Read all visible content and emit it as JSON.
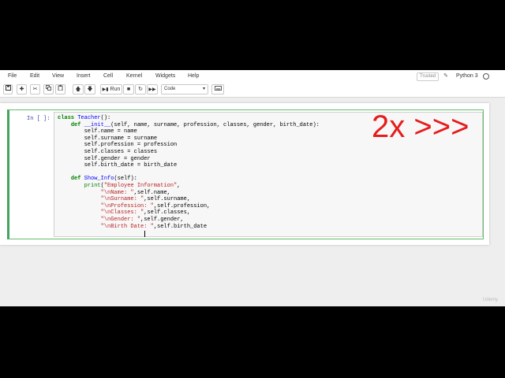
{
  "menubar": {
    "items": [
      "File",
      "Edit",
      "View",
      "Insert",
      "Cell",
      "Kernel",
      "Widgets",
      "Help"
    ],
    "trusted_label": "Trusted",
    "kernel_label": "Python 3"
  },
  "toolbar": {
    "run_label": "Run",
    "cell_type": "Code",
    "icons": [
      "save-icon",
      "add-cell-icon",
      "cut-icon",
      "copy-icon",
      "paste-icon",
      "move-up-icon",
      "move-down-icon",
      "run-icon",
      "stop-icon",
      "restart-icon",
      "fast-forward-icon",
      "keyboard-icon"
    ]
  },
  "cell": {
    "prompt": "In [ ]:",
    "code_lines": [
      "class Teacher():",
      "    def __init__(self, name, surname, profession, classes, gender, birth_date):",
      "        self.name = name",
      "        self.surname = surname",
      "        self.profession = profession",
      "        self.classes = classes",
      "        self.gender = gender",
      "        self.birth_date = birth_date",
      "",
      "    def Show_Info(self):",
      "        print(\"Employee Information\",",
      "             \"\\nName: \",self.name,",
      "             \"\\nSurname: \",self.surname,",
      "             \"\\nProfession: \",self.profession,",
      "             \"\\nClasses: \",self.classes,",
      "             \"\\nGender: \",self.gender,",
      "             \"\\nBirth Date: \",self.birth_date",
      "             "
    ]
  },
  "overlay": {
    "speed_text": "2x >>>",
    "color": "#e61c1c"
  },
  "watermark": "Udemy",
  "colors": {
    "cell_border": "#42a55e",
    "prompt": "#303f9f"
  }
}
